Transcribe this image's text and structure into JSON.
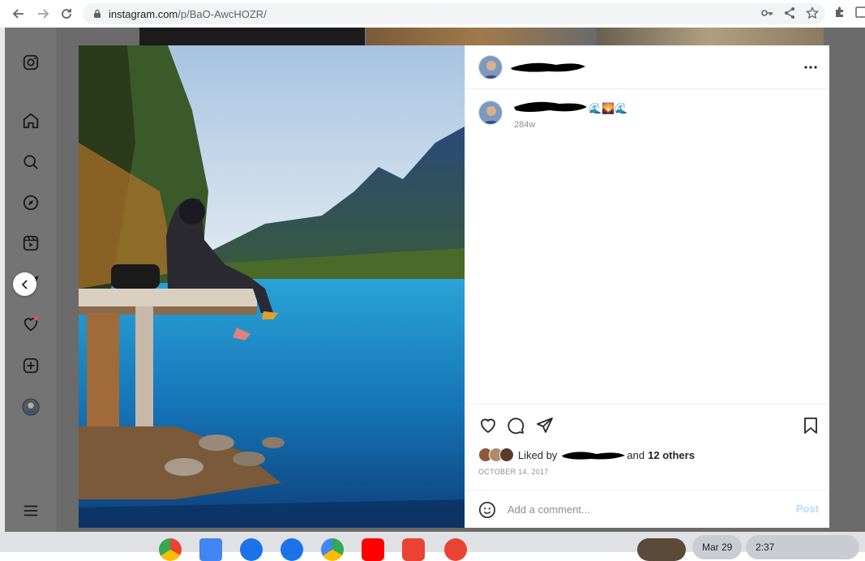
{
  "browser": {
    "url_host": "instagram.com",
    "url_path": "/p/BaO-AwcHOZR/"
  },
  "sidebar": {
    "items": [
      "instagram-logo",
      "home",
      "search",
      "explore",
      "reels",
      "messages",
      "notifications",
      "create",
      "profile",
      "more"
    ]
  },
  "post": {
    "caption_suffix": "🌊🌄🌊",
    "caption_time": "284w",
    "liked_prefix": "Liked by",
    "liked_and": "and",
    "liked_others": "12 others",
    "date": "OCTOBER 14, 2017",
    "comment_placeholder": "Add a comment...",
    "post_label": "Post"
  },
  "shelf": {
    "date": "Mar 29",
    "time": "2:37"
  },
  "colors": {
    "ig_link": "#b3dbff",
    "notification_dot": "#ed4956",
    "dim_overlay": "#6b6b6b"
  }
}
